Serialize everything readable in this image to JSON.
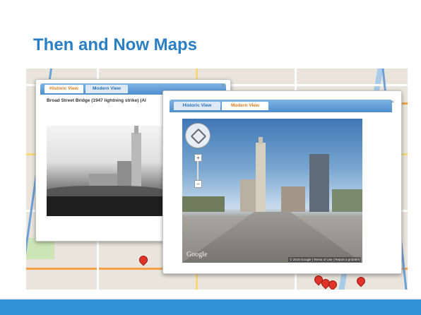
{
  "slide": {
    "title": "Then and Now Maps"
  },
  "colors": {
    "title": "#2a7ec4",
    "footer_bar": "#2f93d6",
    "tab_active_text": "#e07b1c",
    "tab_inactive_text": "#2a6fb6",
    "map_pin": "#e0342a"
  },
  "historic_window": {
    "tabs": [
      {
        "label": "Historic View",
        "active": true
      },
      {
        "label": "Modern View",
        "active": false
      }
    ],
    "caption": "Broad Street Bridge (1947 lightning strike) (Al",
    "close_label": "×"
  },
  "modern_window": {
    "tabs": [
      {
        "label": "Historic View",
        "active": false
      },
      {
        "label": "Modern View",
        "active": true
      }
    ],
    "close_label": "×",
    "zoom_in": "+",
    "zoom_out": "−",
    "watermark": "Google",
    "attribution": "© 2015 Google | Terms of Use | Report a problem"
  },
  "icons": [
    "close-icon",
    "pan-control-icon",
    "zoom-in-icon",
    "zoom-out-icon",
    "map-pin-icon"
  ]
}
